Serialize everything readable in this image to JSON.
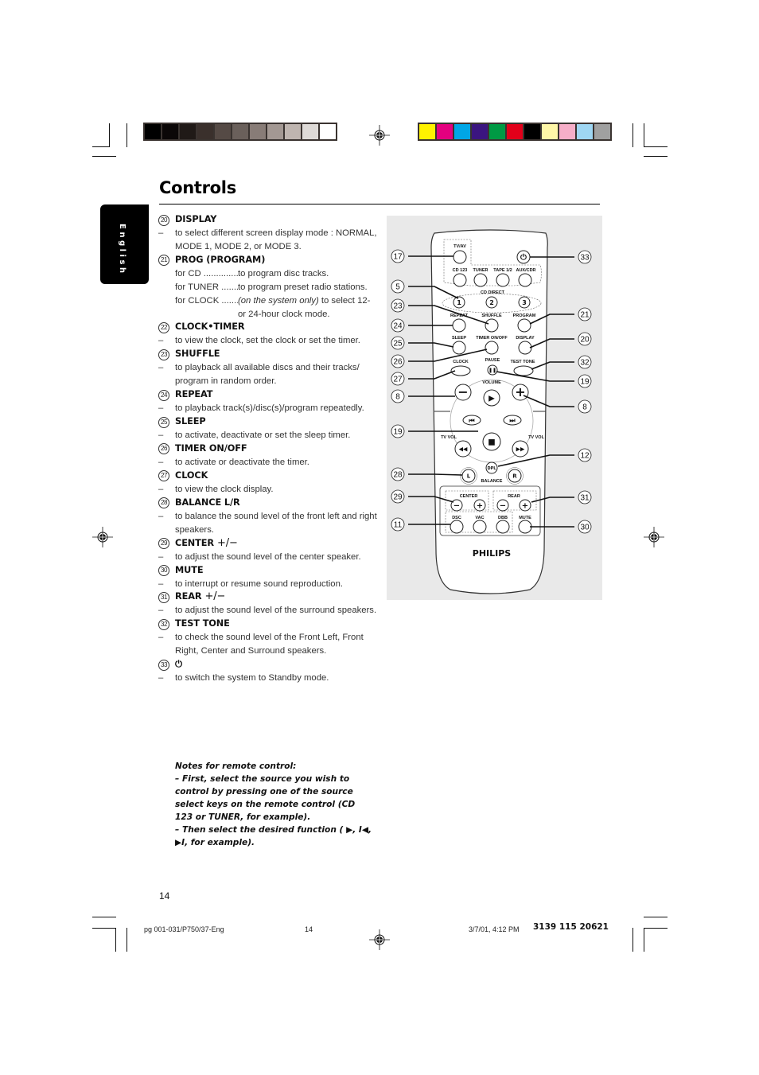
{
  "page": {
    "title": "Controls",
    "language_tab": "English",
    "page_number": "14"
  },
  "print_marks": {
    "grayscale_swatches": [
      "#000000",
      "#0b0707",
      "#201a17",
      "#3a302c",
      "#554a45",
      "#6a605b",
      "#887c77",
      "#a39893",
      "#bfb5b0",
      "#dedad7",
      "#ffffff"
    ],
    "color_swatches": [
      "#fff200",
      "#e4007f",
      "#00a6e6",
      "#3b1580",
      "#009a44",
      "#e2001a",
      "#000000",
      "#fff7a8",
      "#f6aec8",
      "#9fd6f2",
      "#a0a0a0"
    ]
  },
  "items": [
    {
      "num": "20",
      "label": "DISPLAY",
      "desc": [
        "to select different screen display mode : NORMAL, MODE 1, MODE 2, or MODE 3."
      ]
    },
    {
      "num": "21",
      "label": "PROG (PROGRAM)",
      "rows": [
        {
          "key": "for CD ................",
          "value": "to program disc tracks."
        },
        {
          "key": "for TUNER ........",
          "value": "to program preset radio stations."
        },
        {
          "key": "for CLOCK .......",
          "value_italic": "(on the system only)",
          "value": " to select 12- or 24-hour clock mode."
        }
      ]
    },
    {
      "num": "22",
      "label": "CLOCK•TIMER",
      "desc": [
        "to view the clock, set the clock or set the timer."
      ]
    },
    {
      "num": "23",
      "label": "SHUFFLE",
      "desc": [
        "to playback all available discs and their tracks/ program in random order."
      ]
    },
    {
      "num": "24",
      "label": "REPEAT",
      "desc": [
        "to playback track(s)/disc(s)/program repeatedly."
      ]
    },
    {
      "num": "25",
      "label": "SLEEP",
      "desc": [
        "to activate, deactivate or set the sleep timer."
      ]
    },
    {
      "num": "26",
      "label": "TIMER ON/OFF",
      "desc": [
        "to activate or deactivate the timer."
      ]
    },
    {
      "num": "27",
      "label": "CLOCK",
      "desc": [
        "to view the clock display."
      ]
    },
    {
      "num": "28",
      "label": "BALANCE L/R",
      "desc": [
        "to balance the sound level of the front left and right speakers."
      ]
    },
    {
      "num": "29",
      "label": "CENTER",
      "suffix": "+/−",
      "desc": [
        "to adjust the sound level of the center speaker."
      ]
    },
    {
      "num": "30",
      "label": "MUTE",
      "desc": [
        "to interrupt or resume sound reproduction."
      ]
    },
    {
      "num": "31",
      "label": "REAR",
      "suffix": "+/−",
      "desc": [
        "to adjust the sound level of the surround speakers."
      ]
    },
    {
      "num": "32",
      "label": "TEST TONE",
      "desc": [
        "to check the sound level of the Front Left, Front Right, Center and Surround speakers."
      ]
    },
    {
      "num": "33",
      "label": "⏻",
      "desc": [
        "to switch the system to Standby mode."
      ]
    }
  ],
  "notes": {
    "heading": "Notes for remote control:",
    "line1": "–  First, select the source you wish to control by pressing one of the source select keys on the remote control (CD 123 or TUNER, for example).",
    "line2": "–  Then select the desired function ( ▶,  I◀, ▶I, for example)."
  },
  "remote": {
    "brand": "PHILIPS",
    "buttons": {
      "tv_av": "TV/AV",
      "cd123": "CD 123",
      "tuner": "TUNER",
      "tape": "TAPE 1/2",
      "aux": "AUX/CDR",
      "cd_direct": "CD DIRECT",
      "d1": "1",
      "d2": "2",
      "d3": "3",
      "repeat": "REPEAT",
      "shuffle": "SHUFFLE",
      "program": "PROGRAM",
      "sleep": "SLEEP",
      "timer": "TIMER ON/OFF",
      "display": "DISPLAY",
      "clock": "CLOCK",
      "pause": "PAUSE",
      "test_tone": "TEST TONE",
      "volume": "VOLUME",
      "tv_vol_l": "TV VOL",
      "tv_vol_r": "TV VOL",
      "dpl": "DPL",
      "bal_l": "L",
      "bal_r": "R",
      "balance": "BALANCE",
      "center": "CENTER",
      "rear": "REAR",
      "dsc": "DSC",
      "vac": "VAC",
      "dbb": "DBB",
      "mute": "MUTE"
    },
    "callouts_left": [
      "17",
      "5",
      "23",
      "24",
      "25",
      "26",
      "27",
      "8",
      "19",
      "28",
      "29",
      "11"
    ],
    "callouts_right": [
      "33",
      "21",
      "20",
      "32",
      "19",
      "8",
      "12",
      "31",
      "30"
    ]
  },
  "footer": {
    "file": "pg 001-031/P750/37-Eng",
    "page": "14",
    "date": "3/7/01, 4:12 PM",
    "code": "3139 115 20621"
  }
}
